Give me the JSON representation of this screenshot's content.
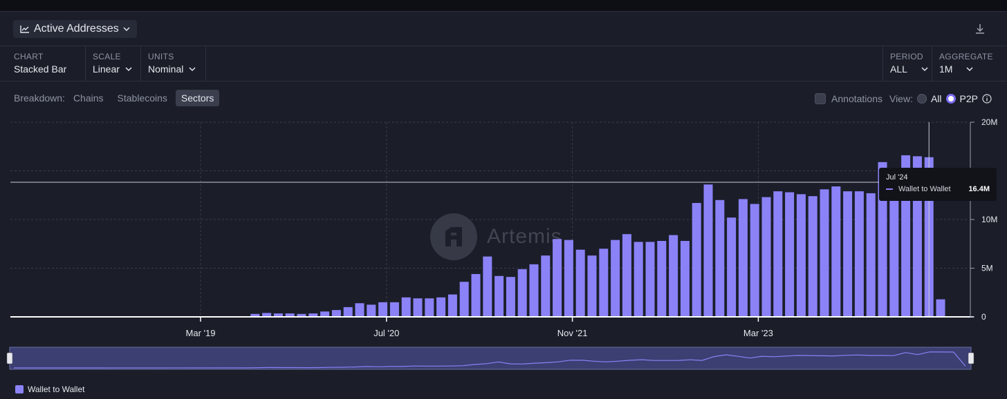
{
  "header": {
    "title": "Active Addresses"
  },
  "toolbar": {
    "chart": {
      "label": "CHART",
      "value": "Stacked Bar"
    },
    "scale": {
      "label": "SCALE",
      "value": "Linear"
    },
    "units": {
      "label": "UNITS",
      "value": "Nominal"
    },
    "period": {
      "label": "PERIOD",
      "value": "ALL"
    },
    "aggregate": {
      "label": "AGGREGATE",
      "value": "1M"
    }
  },
  "breakdown": {
    "label": "Breakdown:",
    "options": [
      "Chains",
      "Stablecoins",
      "Sectors"
    ],
    "active": "Sectors"
  },
  "options": {
    "annotations": "Annotations",
    "view_label": "View:",
    "view_all": "All",
    "view_p2p": "P2P"
  },
  "tooltip": {
    "date": "Jul '24",
    "series": "Wallet to Wallet",
    "value": "16.4M"
  },
  "watermark": "Artemis",
  "colors": {
    "bar": "#8b82f7",
    "accent": "#7b6cf6",
    "background": "#1b1e29"
  },
  "chart_data": {
    "type": "bar",
    "stacked": true,
    "title": "Active Addresses",
    "ylim": [
      0,
      20
    ],
    "y_unit": "M",
    "y_ticks": [
      "0",
      "5M",
      "10M",
      "20M"
    ],
    "x_ticks": [
      "Mar '19",
      "Jul '20",
      "Nov '21",
      "Mar '23"
    ],
    "x_tick_index": [
      0,
      16,
      32,
      48
    ],
    "x_start": "Mar '19",
    "grid": true,
    "legend": "bottom-left",
    "series": [
      {
        "name": "Wallet to Wallet",
        "color": "#8b82f7",
        "values": [
          0.05,
          0.3,
          0.4,
          0.35,
          0.35,
          0.3,
          0.35,
          0.55,
          0.7,
          1.0,
          1.4,
          1.25,
          1.5,
          1.5,
          2.0,
          1.9,
          1.9,
          2.0,
          2.3,
          3.6,
          4.4,
          6.2,
          4.2,
          4.1,
          4.9,
          5.4,
          6.3,
          8.0,
          7.9,
          6.9,
          6.3,
          7.0,
          7.9,
          8.5,
          7.7,
          7.7,
          7.8,
          8.4,
          7.8,
          11.7,
          13.6,
          12.0,
          10.2,
          12.1,
          11.6,
          12.3,
          12.9,
          12.8,
          12.6,
          12.4,
          13.1,
          13.4,
          12.9,
          12.9,
          12.7,
          15.9,
          13.8,
          16.6,
          16.5,
          16.4,
          1.8
        ]
      }
    ]
  }
}
